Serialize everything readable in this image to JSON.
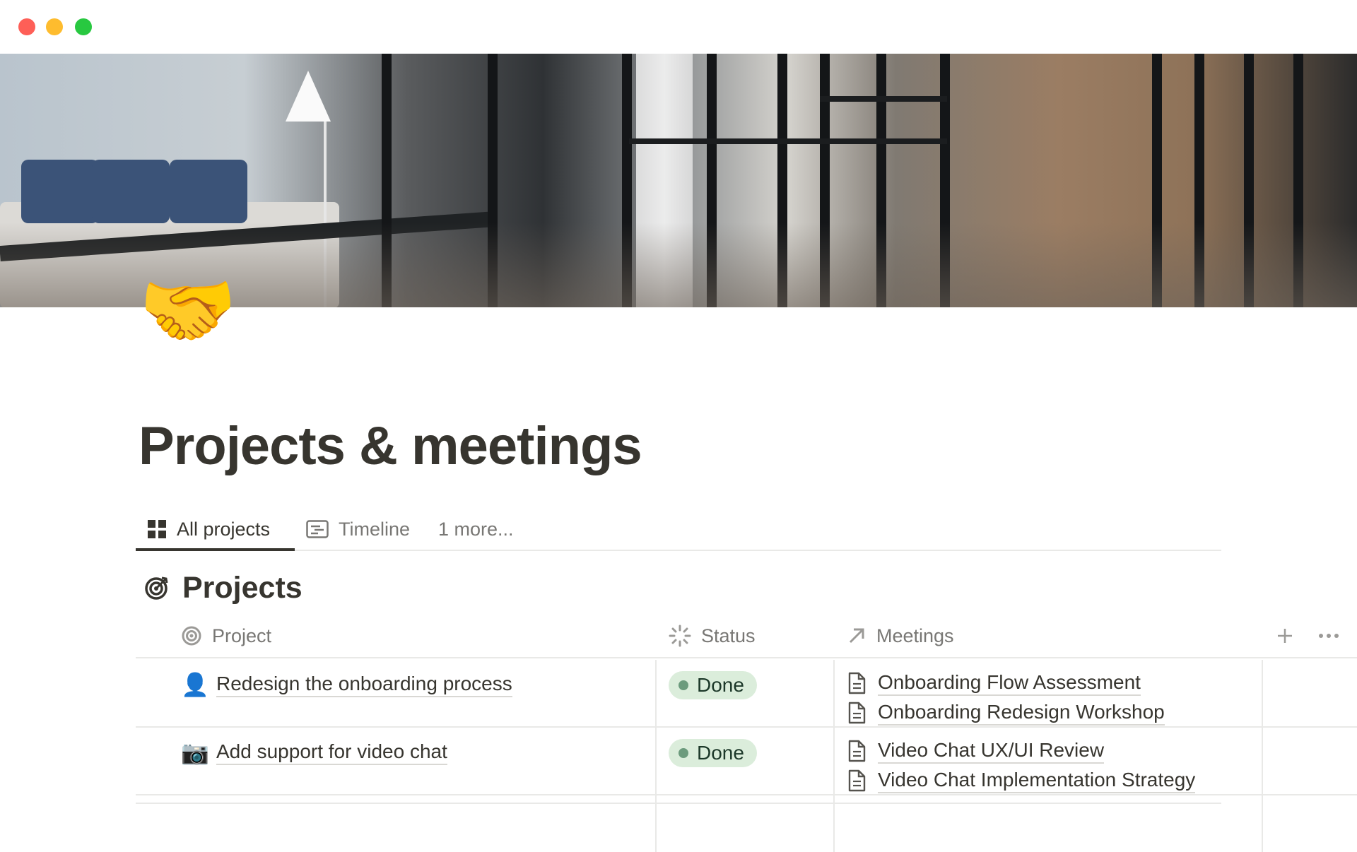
{
  "window": {
    "traffic_lights": [
      "close",
      "minimize",
      "maximize"
    ]
  },
  "cover": {
    "description_icon": "office-corridor-photo"
  },
  "page": {
    "icon": "🤝",
    "title": "Projects & meetings"
  },
  "tabs": [
    {
      "label": "All projects",
      "icon": "grid-icon",
      "active": true
    },
    {
      "label": "Timeline",
      "icon": "timeline-icon",
      "active": false
    },
    {
      "label": "1 more...",
      "active": false
    }
  ],
  "database": {
    "title": "Projects",
    "icon": "target-icon",
    "columns": [
      {
        "label": "Project",
        "icon": "target-icon"
      },
      {
        "label": "Status",
        "icon": "loading-spinner-icon"
      },
      {
        "label": "Meetings",
        "icon": "arrow-up-right-icon"
      }
    ],
    "rows": [
      {
        "emoji": "👤",
        "project": "Redesign the onboarding process",
        "status": "Done",
        "meetings": [
          "Onboarding Flow Assessment",
          "Onboarding Redesign Workshop"
        ]
      },
      {
        "emoji": "📷",
        "project": "Add support for video chat",
        "status": "Done",
        "meetings": [
          "Video Chat UX/UI Review",
          "Video Chat Implementation Strategy"
        ]
      }
    ]
  },
  "colors": {
    "text": "#37352f",
    "muted": "#787774",
    "done_bg": "#dbeddb",
    "done_dot": "#6c9b7d",
    "divider": "#e9e9e7"
  }
}
